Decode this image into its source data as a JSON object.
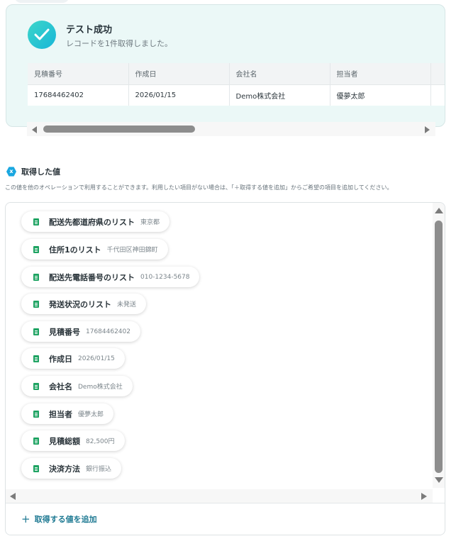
{
  "result": {
    "title": "テスト成功",
    "subtitle": "レコードを1件取得しました。",
    "columns": [
      "見積番号",
      "作成日",
      "会社名",
      "担当者"
    ],
    "row": [
      "17684462402",
      "2026/01/15",
      "Demo株式会社",
      "優夢太郎"
    ]
  },
  "values_section": {
    "badge": "x",
    "title": "取得した値",
    "description": "この値を他のオペレーションで利用することができます。利用したい項目がない場合は、「＋取得する値を追加」からご希望の項目を追加してください。"
  },
  "values": [
    {
      "label": "配送先都道府県のリスト",
      "value": "東京都"
    },
    {
      "label": "住所1のリスト",
      "value": "千代田区神田錦町"
    },
    {
      "label": "配送先電話番号のリスト",
      "value": "010-1234-5678"
    },
    {
      "label": "発送状況のリスト",
      "value": "未発送"
    },
    {
      "label": "見積番号",
      "value": "17684462402"
    },
    {
      "label": "作成日",
      "value": "2026/01/15"
    },
    {
      "label": "会社名",
      "value": "Demo株式会社"
    },
    {
      "label": "担当者",
      "value": "優夢太郎"
    },
    {
      "label": "見積総額",
      "value": "82,500円"
    },
    {
      "label": "決済方法",
      "value": "銀行振込"
    }
  ],
  "add_button": {
    "icon": "+",
    "label": "取得する値を追加"
  },
  "icons": {
    "success": "check-icon",
    "value": "sheet-icon",
    "badge": "x-badge-icon"
  },
  "colors": {
    "accent": "#1f7a93",
    "success": "#22c4d2",
    "sheet": "#1ea362",
    "card_bg": "#ebf8f7"
  }
}
